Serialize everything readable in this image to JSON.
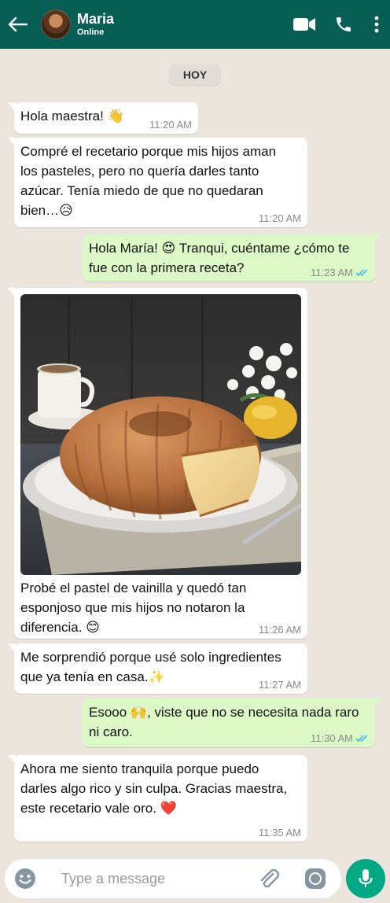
{
  "header": {
    "back_icon": "arrow-left-icon",
    "contact_name": "Maria",
    "contact_status": "Online",
    "icons": [
      "video-call-icon",
      "phone-icon",
      "more-vert-icon"
    ]
  },
  "chat": {
    "date_label": "HOY",
    "messages": [
      {
        "dir": "in",
        "text": "Hola maestra! 👋",
        "time": "11:20 AM"
      },
      {
        "dir": "in",
        "text": "Compré el recetario porque mis hijos aman los pasteles, pero no quería darles tanto azúcar. Tenía miedo de que no quedaran bien…😥",
        "time": "11:20 AM"
      },
      {
        "dir": "out",
        "text": "Hola María! 😍 Tranqui, cuéntame ¿cómo te fue con la primera receta?",
        "time": "11:23 AM"
      },
      {
        "dir": "in",
        "text": "Probé el pastel de vainilla y quedó tan esponjoso que mis hijos no notaron la diferencia. 😊",
        "time": "11:26 AM",
        "image": "vanilla-bundt-cake-photo"
      },
      {
        "dir": "in",
        "text": "Me sorprendió porque usé solo ingredientes que ya tenía en casa.✨",
        "time": "11:27 AM"
      },
      {
        "dir": "out",
        "text": "Esooo 🙌, viste que no se necesita nada raro ni caro.",
        "time": "11:30 AM"
      },
      {
        "dir": "in",
        "text": "Ahora me siento tranquila porque puedo darles algo rico y sin culpa. Gracias maestra, este recetario vale oro. ❤️",
        "time": "11:35 AM"
      }
    ]
  },
  "composer": {
    "placeholder": "Type a message",
    "icons": [
      "emoji-icon",
      "attach-icon",
      "camera-icon",
      "mic-icon"
    ]
  },
  "colors": {
    "header": "#075e54",
    "chat_bg": "#ece5dd",
    "outgoing_bubble": "#dcf8c6",
    "incoming_bubble": "#ffffff",
    "read_ticks": "#34b7f1",
    "mic_button": "#00a884"
  }
}
